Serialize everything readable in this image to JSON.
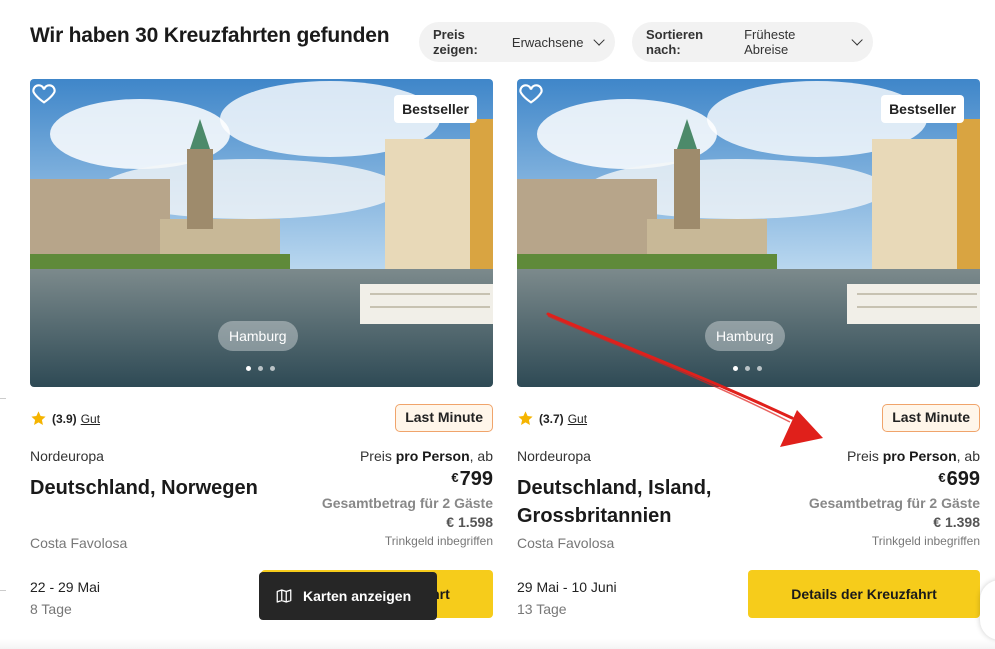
{
  "header": {
    "result_title": "Wir haben 30 Kreuzfahrten gefunden",
    "price_filter": {
      "label": "Preis zeigen:",
      "value": "Erwachsene"
    },
    "sort_filter": {
      "label": "Sortieren nach:",
      "value": "Früheste Abreise"
    }
  },
  "cards": [
    {
      "badge": "Bestseller",
      "city": "Hamburg",
      "rating_score": "(3.9)",
      "rating_word": "Gut",
      "tag": "Last Minute",
      "region": "Nordeuropa",
      "route": "Deutschland, Norwegen",
      "ship": "Costa Favolosa",
      "price_prefix": "Preis",
      "price_basis": "pro Person",
      "price_suffix": ", ab",
      "currency": "€",
      "price": "799",
      "total_label": "Gesamtbetrag für 2 Gäste",
      "total_value": "€ 1.598",
      "tip": "Trinkgeld inbegriffen",
      "dates": "22 - 29 Mai",
      "nights": "8 Tage",
      "cta": "Details der Kreuzfahrt"
    },
    {
      "badge": "Bestseller",
      "city": "Hamburg",
      "rating_score": "(3.7)",
      "rating_word": "Gut",
      "tag": "Last Minute",
      "region": "Nordeuropa",
      "route": "Deutschland, Island, Grossbritannien",
      "ship": "Costa Favolosa",
      "price_prefix": "Preis",
      "price_basis": "pro Person",
      "price_suffix": ", ab",
      "currency": "€",
      "price": "699",
      "total_label": "Gesamtbetrag für 2 Gäste",
      "total_value": "€ 1.398",
      "tip": "Trinkgeld inbegriffen",
      "dates": "29 Mai - 10 Juni",
      "nights": "13 Tage",
      "cta": "Details der Kreuzfahrt"
    }
  ],
  "map_button": {
    "label": "Karten anzeigen",
    "icon": "map-icon"
  },
  "colors": {
    "cta_yellow": "#f6cc1b",
    "last_minute_border": "#f0a46b",
    "annotation_red": "#e0201b",
    "star": "#f5b400",
    "map_button_bg": "#262626"
  }
}
